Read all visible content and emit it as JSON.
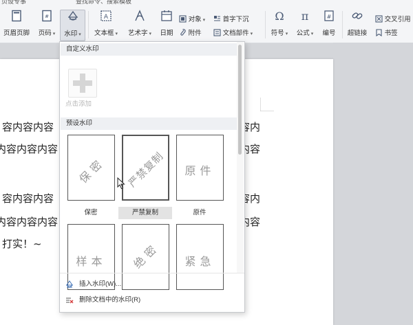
{
  "topstrip": {
    "left": "页设专事",
    "search": "查找命令、搜索模板"
  },
  "ribbon": {
    "header_footer": "页眉页脚",
    "page_number": "页码",
    "watermark": "水印",
    "textbox": "文本框",
    "wordart": "艺术字",
    "date": "日期",
    "object": "对象",
    "attachment": "附件",
    "dropcap": "首字下沉",
    "doc_parts": "文档部件",
    "symbol": "符号",
    "formula": "公式",
    "numbering": "编号",
    "hyperlink": "超链接",
    "crossref": "交叉引用",
    "bookmark": "书签"
  },
  "document": {
    "lines": [
      {
        "left": "容内容内容",
        "right": "容内"
      },
      {
        "left": "内容内容内容",
        "right": "内容"
      },
      {
        "left": "容内容内容",
        "right": "容内"
      },
      {
        "left": "内容内容内容",
        "right": "内容"
      },
      {
        "left": "打实！~",
        "right": ""
      }
    ]
  },
  "dropdown": {
    "custom_section": "自定义水印",
    "add_label": "点击添加",
    "preset_section": "预设水印",
    "presets": [
      {
        "text": "保密",
        "caption": "保密"
      },
      {
        "text": "严禁复制",
        "caption": "严禁复制"
      },
      {
        "text": "原件",
        "caption": "原件"
      },
      {
        "text": "样本",
        "caption": ""
      },
      {
        "text": "绝密",
        "caption": ""
      },
      {
        "text": "紧急",
        "caption": ""
      }
    ],
    "insert_label": "插入水印(W)...",
    "delete_label": "删除文档中的水印(R)"
  }
}
